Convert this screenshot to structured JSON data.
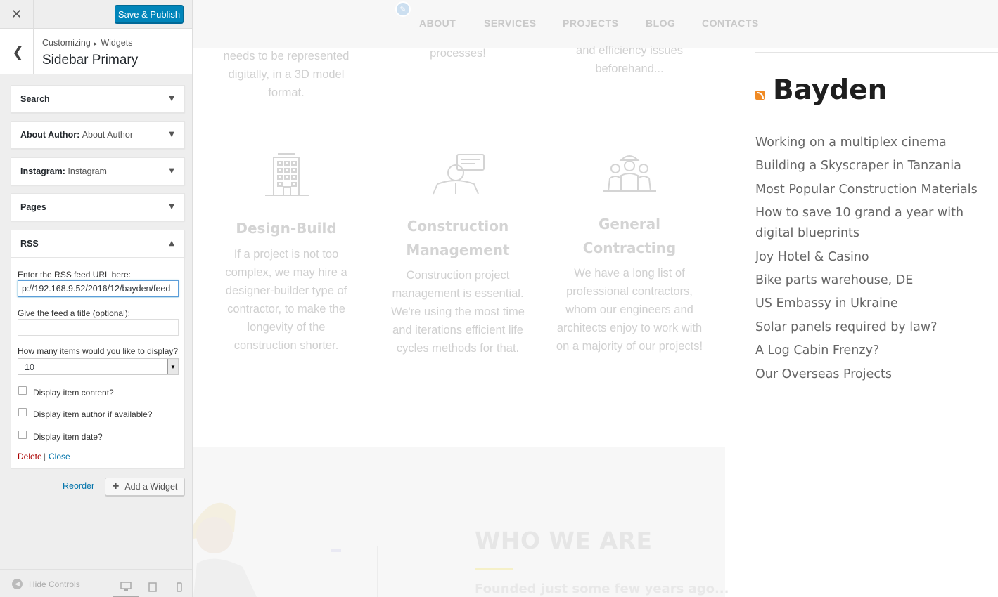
{
  "panel": {
    "close_icon": "close-icon",
    "save_label": "Save & Publish",
    "breadcrumb_root": "Customizing",
    "breadcrumb_child": "Widgets",
    "section_name": "Sidebar Primary",
    "widgets": [
      {
        "title": "Search",
        "subtitle": ""
      },
      {
        "title": "About Author",
        "subtitle": "About Author"
      },
      {
        "title": "Instagram",
        "subtitle": "Instagram"
      },
      {
        "title": "Pages",
        "subtitle": ""
      },
      {
        "title": "RSS",
        "subtitle": ""
      }
    ],
    "rss_form": {
      "url_label": "Enter the RSS feed URL here:",
      "url_value": "p://192.168.9.52/2016/12/bayden/feed",
      "title_label": "Give the feed a title (optional):",
      "title_value": "",
      "count_label": "How many items would you like to display?",
      "count_value": "10",
      "opt_content": "Display item content?",
      "opt_author": "Display item author if available?",
      "opt_date": "Display item date?",
      "delete_label": "Delete",
      "separator": "|",
      "close_label": "Close"
    },
    "reorder_label": "Reorder",
    "add_widget_label": "Add a Widget",
    "hide_controls_label": "Hide Controls"
  },
  "preview": {
    "nav": [
      "ABOUT",
      "SERVICES",
      "PROJECTS",
      "BLOG",
      "CONTACTS"
    ],
    "top_fragments": [
      "needs to be represented digitally, in a 3D model format.",
      "processes!",
      "and efficiency issues beforehand..."
    ],
    "services": [
      {
        "title": "Design-Build",
        "text": "If a project is not too complex, we may hire a designer-builder type of contractor, to make the longevity of the construction shorter."
      },
      {
        "title": "Construction Management",
        "text": "Construction project management is essential. We're using the most time and iterations efficient life cycles methods for that."
      },
      {
        "title": "General Contracting",
        "text": "We have a long list of professional contractors, whom our engineers and architects enjoy to work with on a majority of our projects!"
      }
    ],
    "rss_title": "Bayden",
    "rss_items": [
      "Working on a multiplex cinema",
      "Building a Skyscraper in Tanzania",
      "Most Popular Construction Materials",
      "How to save 10 grand a year with digital blueprints",
      "Joy Hotel & Casino",
      "Bike parts warehouse, DE",
      "US Embassy in Ukraine",
      "Solar panels required by law?",
      "A Log Cabin Frenzy?",
      "Our Overseas Projects"
    ],
    "who_title": "WHO WE ARE",
    "who_sub": "Founded just some few years ago..."
  }
}
